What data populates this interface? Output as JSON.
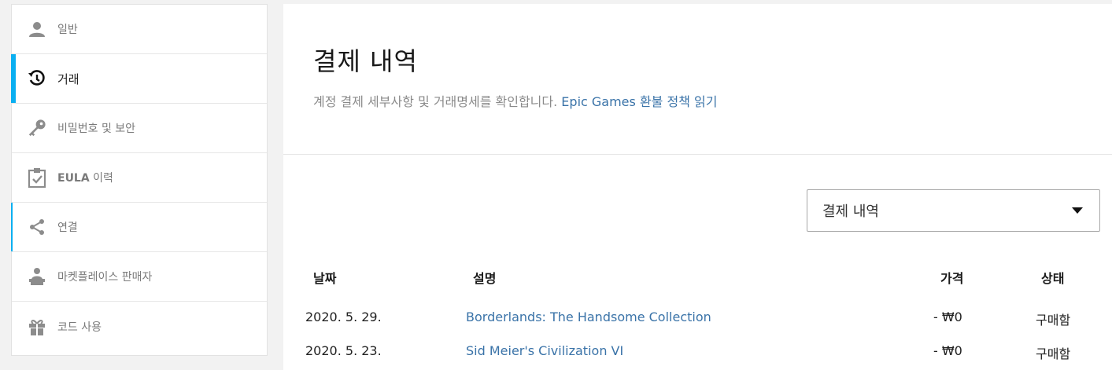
{
  "sidebar": {
    "items": [
      {
        "label": "일반",
        "icon": "user-icon"
      },
      {
        "label": "거래",
        "icon": "history-icon"
      },
      {
        "label": "비밀번호 및 보안",
        "icon": "key-icon"
      },
      {
        "label_bold": "EULA",
        "label_rest": " 이력",
        "icon": "clipboard-check-icon"
      },
      {
        "label": "연결",
        "icon": "share-icon"
      },
      {
        "label": "마켓플레이스 판매자",
        "icon": "seller-icon"
      },
      {
        "label": "코드 사용",
        "icon": "gift-icon"
      }
    ],
    "active_index": 1
  },
  "main": {
    "title": "결제 내역",
    "subtitle": "계정 결제 세부사항 및 거래명세를 확인합니다. ",
    "refund_link": "Epic Games 환불 정책 읽기",
    "filter": {
      "selected": "결제 내역"
    },
    "table": {
      "headers": {
        "date": "날짜",
        "description": "설명",
        "price": "가격",
        "status": "상태"
      },
      "rows": [
        {
          "date": "2020. 5. 29.",
          "description": "Borderlands: The Handsome Collection",
          "price": "- ₩0",
          "status": "구매함"
        },
        {
          "date": "2020. 5. 23.",
          "description": "Sid Meier's Civilization VI",
          "price": "- ₩0",
          "status": "구매함"
        }
      ]
    }
  },
  "colors": {
    "accent": "#0aaff1",
    "link": "#3a73a8"
  }
}
